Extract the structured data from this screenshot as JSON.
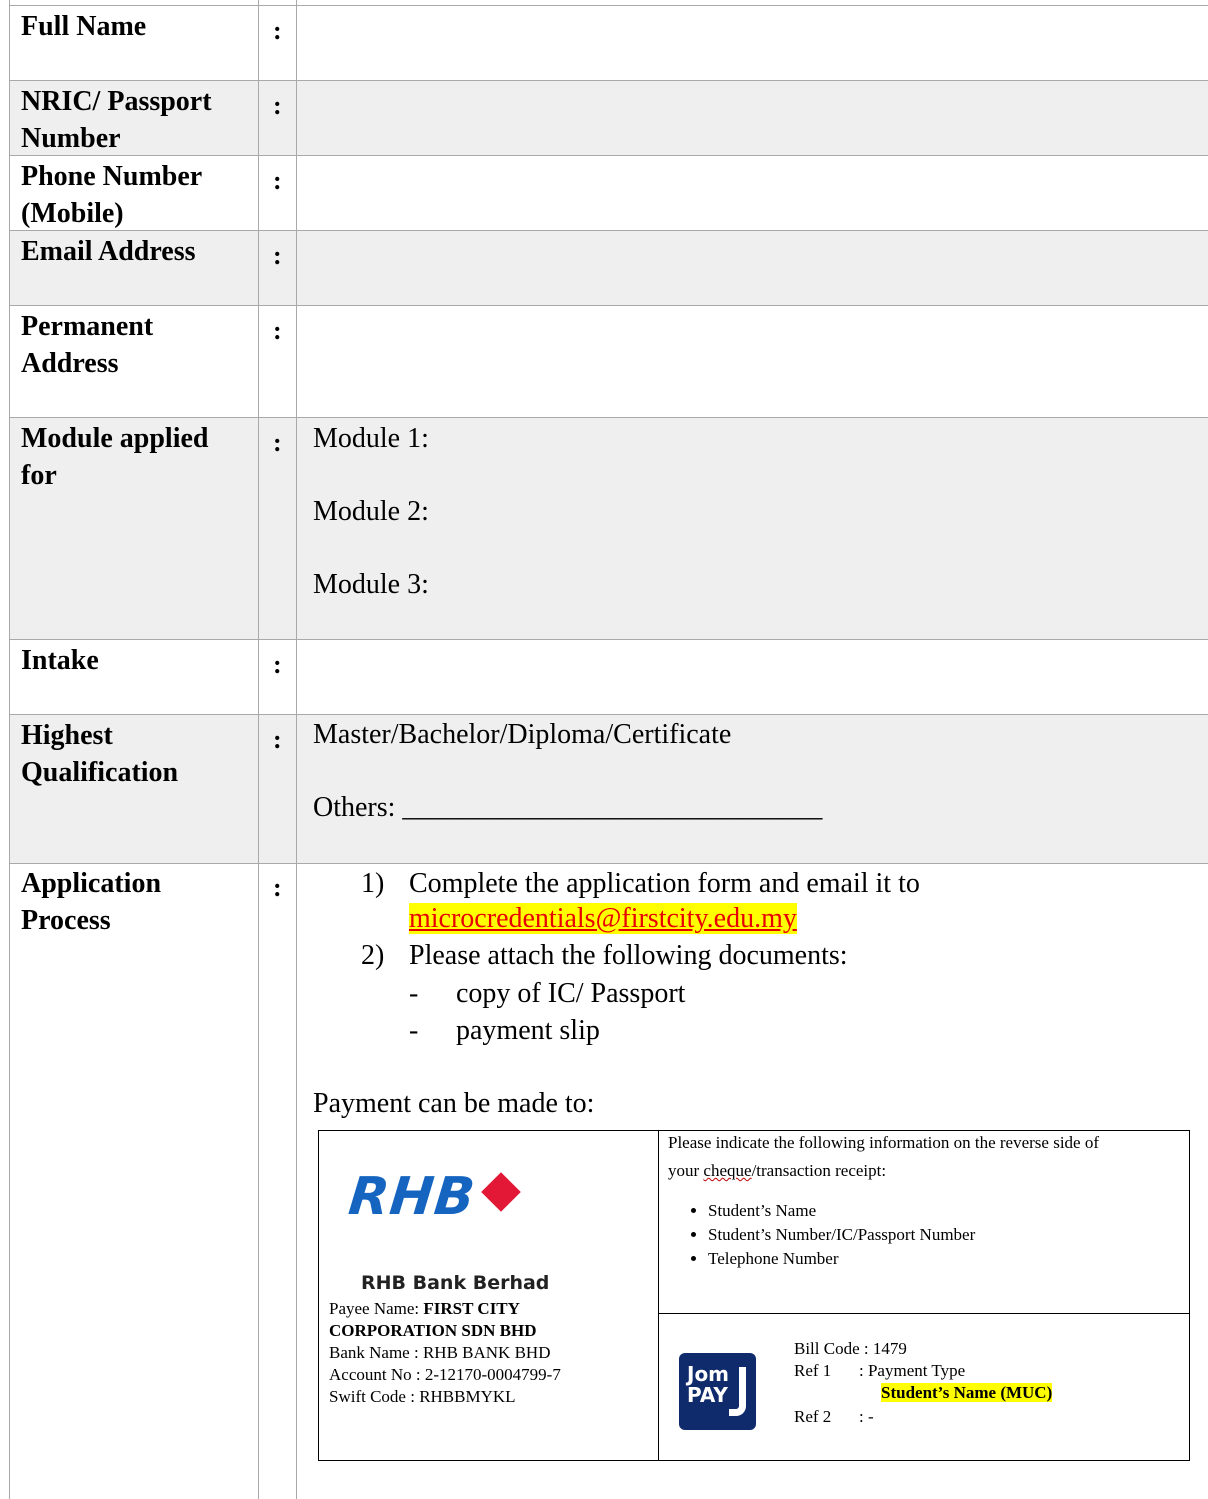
{
  "form": {
    "rows": [
      {
        "label": "Full Name",
        "colon": ":"
      },
      {
        "label_line1": "NRIC/ Passport",
        "label_line2": "Number",
        "colon": ":"
      },
      {
        "label_line1": "Phone Number",
        "label_line2": "(Mobile)",
        "colon": ":"
      },
      {
        "label": "Email Address",
        "colon": ":"
      },
      {
        "label_line1": "Permanent",
        "label_line2": "Address",
        "colon": ":"
      },
      {
        "label_line1": "Module applied",
        "label_line2": "for",
        "colon": ":",
        "values": [
          "Module 1:",
          "Module 2:",
          "Module 3:"
        ]
      },
      {
        "label": "Intake",
        "colon": ":"
      },
      {
        "label_line1": "Highest",
        "label_line2": "Qualification",
        "colon": ":",
        "values": [
          "Master/Bachelor/Diploma/Certificate",
          "Others: ______________________________"
        ]
      },
      {
        "label_line1": "Application",
        "label_line2": "Process",
        "colon": ":"
      }
    ]
  },
  "application_process": {
    "step1_num": "1)",
    "step1_text": "Complete the application form and email it to",
    "email": "microcredentials@firstcity.edu.my",
    "step2_num": "2)",
    "step2_text": "Please attach the following documents:",
    "docs": [
      {
        "dash": "-",
        "text": "copy of  IC/ Passport"
      },
      {
        "dash": "-",
        "text": "payment slip"
      }
    ],
    "payment_intro": "Payment can be made to:"
  },
  "payment": {
    "bank_logo_text": "RHB",
    "bank_full_name": "RHB Bank Berhad",
    "payee_label": "Payee Name:",
    "payee_name_1": "FIRST CITY",
    "payee_name_2": "CORPORATION SDN BHD",
    "bank_name": "Bank Name : RHB BANK BHD",
    "account_no": "Account No : 2-12170-0004799-7",
    "swift_code": "Swift Code  : RHBBMYKL",
    "instruction_1": "Please indicate the following information on the reverse side of",
    "instruction_2a": "your ",
    "instruction_2b": "cheque",
    "instruction_2c": "/transaction receipt:",
    "info_items": [
      "Student’s Name",
      "Student’s Number/IC/Passport Number",
      "Telephone Number"
    ],
    "jompay_1": "Jom",
    "jompay_2": "PAY",
    "bill_code": "Bill Code : 1479",
    "ref1_label": "Ref 1",
    "ref1_value": ": Payment Type",
    "ref1_highlight": "Student’s Name (MUC)",
    "ref2_label": "Ref 2",
    "ref2_value": ": -"
  },
  "colors": {
    "shade": "#efefef",
    "border": "#a9a9a9",
    "link": "#e80000",
    "highlight": "#ffff00",
    "rhb_blue": "#1565c0",
    "rhb_red": "#e31837",
    "jompay_navy": "#0f2b6b"
  }
}
